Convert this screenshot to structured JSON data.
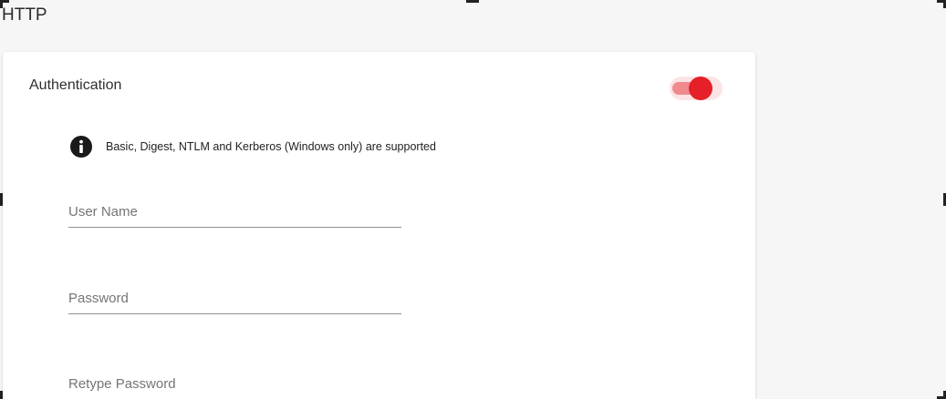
{
  "section": {
    "title": "HTTP"
  },
  "auth": {
    "title": "Authentication",
    "enabled": true,
    "toggle_color": "#e52028",
    "info_icon": "info-icon",
    "info_text": "Basic, Digest, NTLM and Kerberos (Windows only) are supported",
    "fields": {
      "username": {
        "placeholder": "User Name",
        "value": ""
      },
      "password": {
        "placeholder": "Password",
        "value": ""
      },
      "retype": {
        "placeholder": "Retype Password",
        "value": ""
      }
    }
  }
}
